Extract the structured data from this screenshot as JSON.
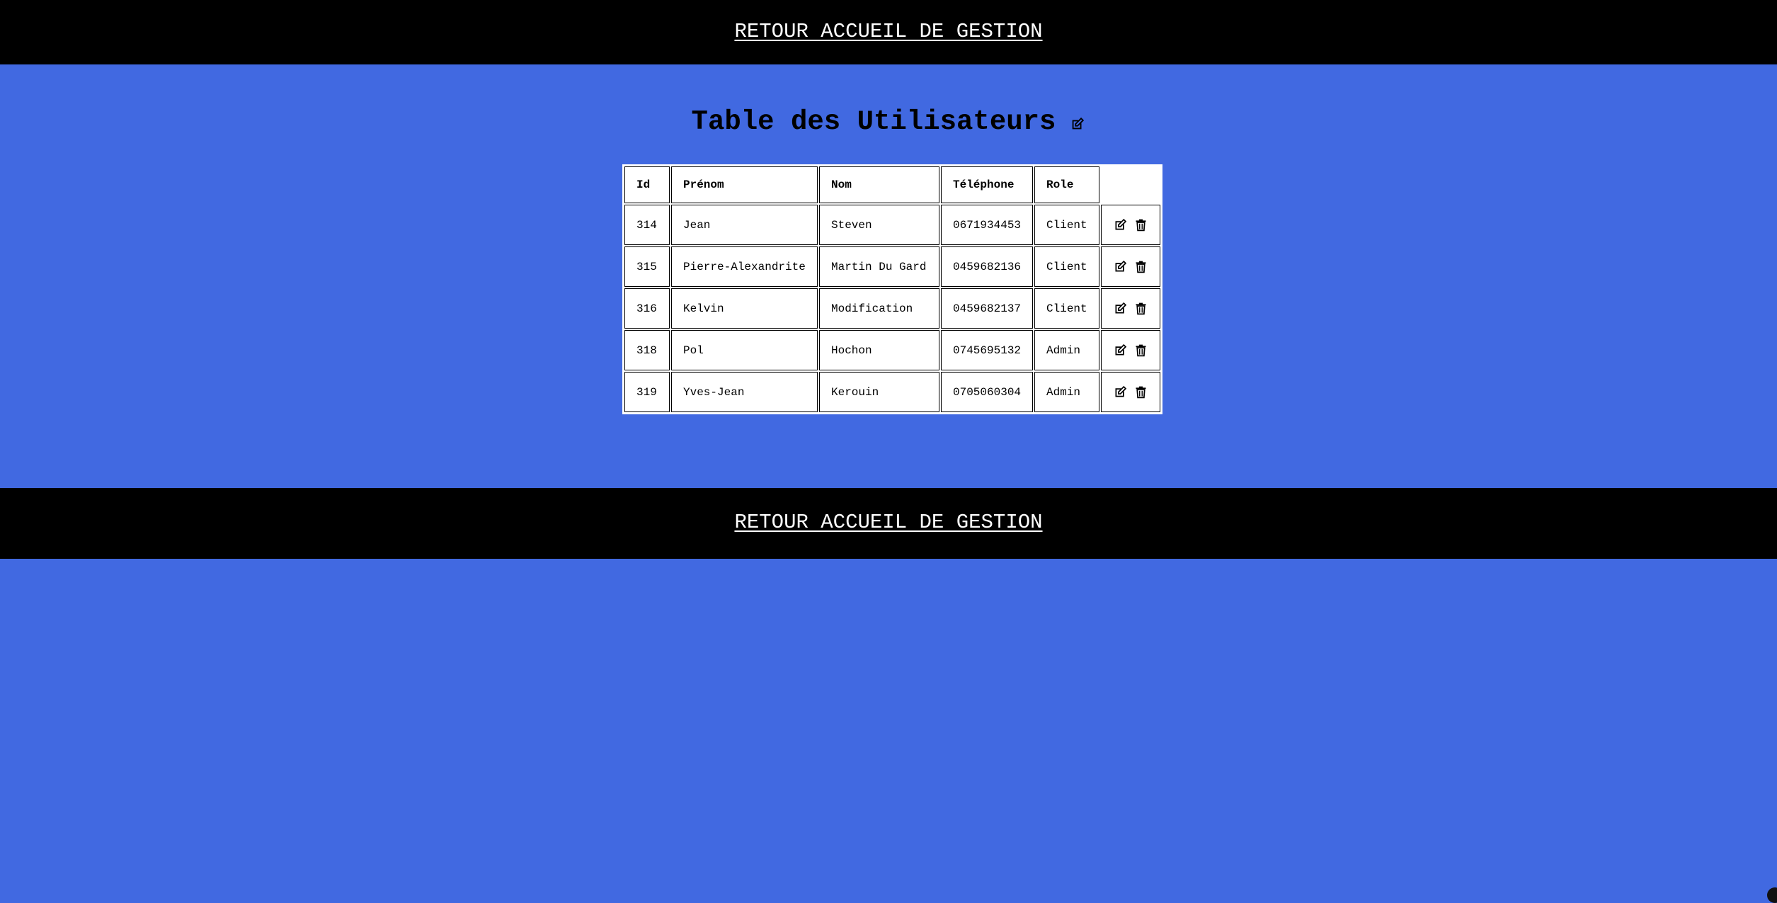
{
  "nav": {
    "top_link": "RETOUR ACCUEIL DE GESTION",
    "bottom_link": "RETOUR ACCUEIL DE GESTION"
  },
  "page": {
    "title": "Table des Utilisateurs",
    "title_icon": "edit-icon"
  },
  "table": {
    "headers": [
      "Id",
      "Prénom",
      "Nom",
      "Téléphone",
      "Role"
    ],
    "rows": [
      {
        "id": "314",
        "prenom": "Jean",
        "nom": "Steven",
        "telephone": "0671934453",
        "role": "Client"
      },
      {
        "id": "315",
        "prenom": "Pierre-Alexandrite",
        "nom": "Martin Du Gard",
        "telephone": "0459682136",
        "role": "Client"
      },
      {
        "id": "316",
        "prenom": "Kelvin",
        "nom": "Modification",
        "telephone": "0459682137",
        "role": "Client"
      },
      {
        "id": "318",
        "prenom": "Pol",
        "nom": "Hochon",
        "telephone": "0745695132",
        "role": "Admin"
      },
      {
        "id": "319",
        "prenom": "Yves-Jean",
        "nom": "Kerouin",
        "telephone": "0705060304",
        "role": "Admin"
      }
    ],
    "row_action_icons": [
      "edit-icon",
      "trash-icon"
    ]
  },
  "colors": {
    "background": "#4169e1",
    "bar": "#000000",
    "link": "#ffffff",
    "table_bg": "#ffffff"
  }
}
